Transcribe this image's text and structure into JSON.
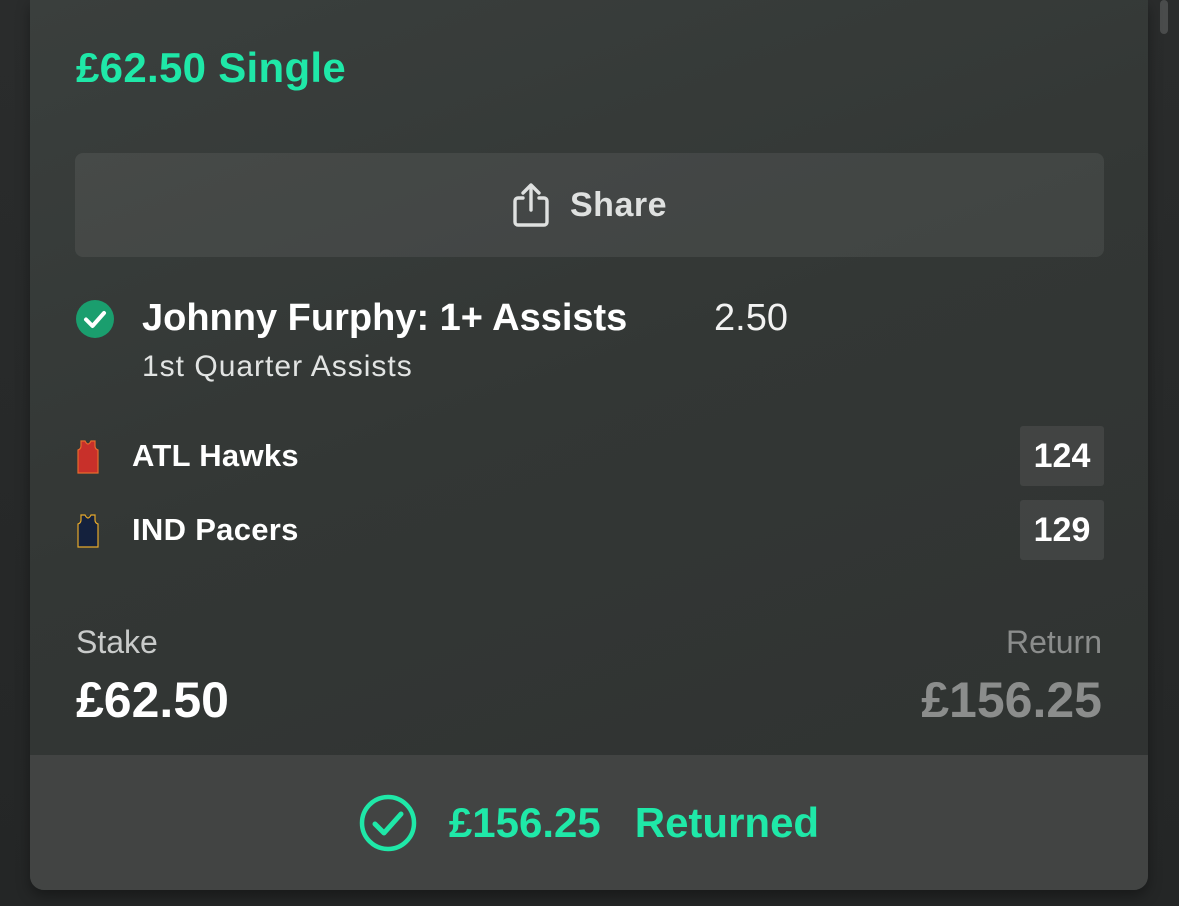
{
  "bet": {
    "title": "£62.50 Single"
  },
  "share": {
    "label": "Share",
    "icon": "share-icon"
  },
  "selection": {
    "status_icon": "check-circle-icon",
    "name": "Johnny Furphy: 1+ Assists",
    "odds": "2.50",
    "market": "1st Quarter Assists"
  },
  "teams": [
    {
      "name": "ATL Hawks",
      "score": "124",
      "icon": "jersey-icon",
      "jersey_color": "#c8302a"
    },
    {
      "name": "IND Pacers",
      "score": "129",
      "icon": "jersey-icon",
      "jersey_color": "#14213d"
    }
  ],
  "stake": {
    "label": "Stake",
    "value": "£62.50"
  },
  "return": {
    "label": "Return",
    "value": "£156.25"
  },
  "result": {
    "icon": "check-circle-outline-icon",
    "amount": "£156.25",
    "status": "Returned"
  },
  "colors": {
    "accent": "#1fe8a8",
    "win_badge": "#1a9e6e",
    "card_bg": "#363a38",
    "result_bar_bg": "#424443"
  }
}
